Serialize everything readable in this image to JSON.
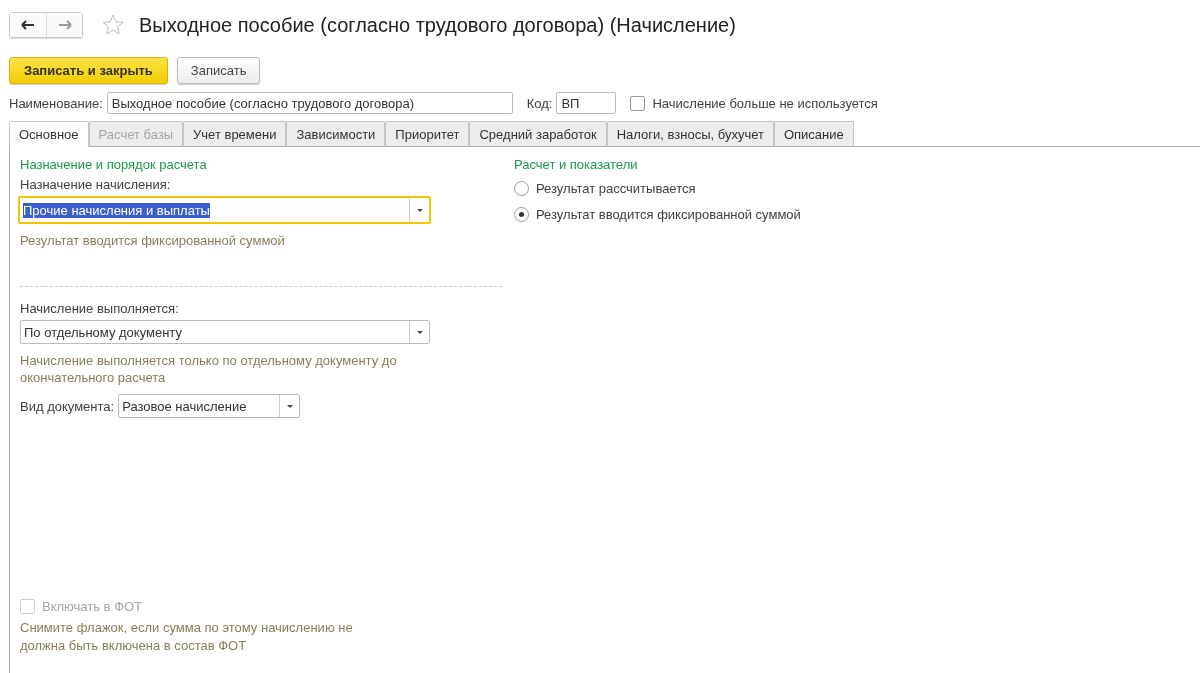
{
  "window": {
    "title": "Выходное пособие (согласно трудового договора) (Начисление)",
    "favorite": false
  },
  "toolbar": {
    "buttons": [
      {
        "label": "Записать и закрыть",
        "kind": "primary"
      },
      {
        "label": "Записать",
        "kind": "default"
      }
    ]
  },
  "header": {
    "name_label": "Наименование:",
    "name_value": "Выходное пособие (согласно трудового договора)",
    "code_label": "Код:",
    "code_value": "ВП",
    "unused": {
      "label": "Начисление больше не используется",
      "checked": false
    }
  },
  "tabs": [
    {
      "label": "Основное",
      "selected": true,
      "disabled": false
    },
    {
      "label": "Расчет базы",
      "selected": false,
      "disabled": true
    },
    {
      "label": "Учет времени",
      "selected": false,
      "disabled": false
    },
    {
      "label": "Зависимости",
      "selected": false,
      "disabled": false
    },
    {
      "label": "Приоритет",
      "selected": false,
      "disabled": false
    },
    {
      "label": "Средний заработок",
      "selected": false,
      "disabled": false
    },
    {
      "label": "Налоги, взносы, бухучет",
      "selected": false,
      "disabled": false
    },
    {
      "label": "Описание",
      "selected": false,
      "disabled": false
    }
  ],
  "left": {
    "section_title": "Назначение и порядок расчета",
    "purpose_label": "Назначение начисления:",
    "purpose_value": "Прочие начисления и выплаты",
    "purpose_hint": "Результат вводится фиксированной суммой",
    "exec_label": "Начисление выполняется:",
    "exec_value": "По отдельному документу",
    "exec_hint": "Начисление выполняется только по отдельному документу до окончательного расчета",
    "doc_label": "Вид документа:",
    "doc_value": "Разовое начисление",
    "fot": {
      "label": "Включать в ФОТ",
      "checked": false,
      "disabled": true
    },
    "fot_hint": "Снимите флажок, если сумма по этому начислению не должна быть включена в состав ФОТ"
  },
  "right": {
    "section_title": "Расчет и показатели",
    "options": [
      {
        "label": "Результат рассчитывается",
        "selected": false
      },
      {
        "label": "Результат вводится фиксированной суммой",
        "selected": true
      }
    ]
  }
}
